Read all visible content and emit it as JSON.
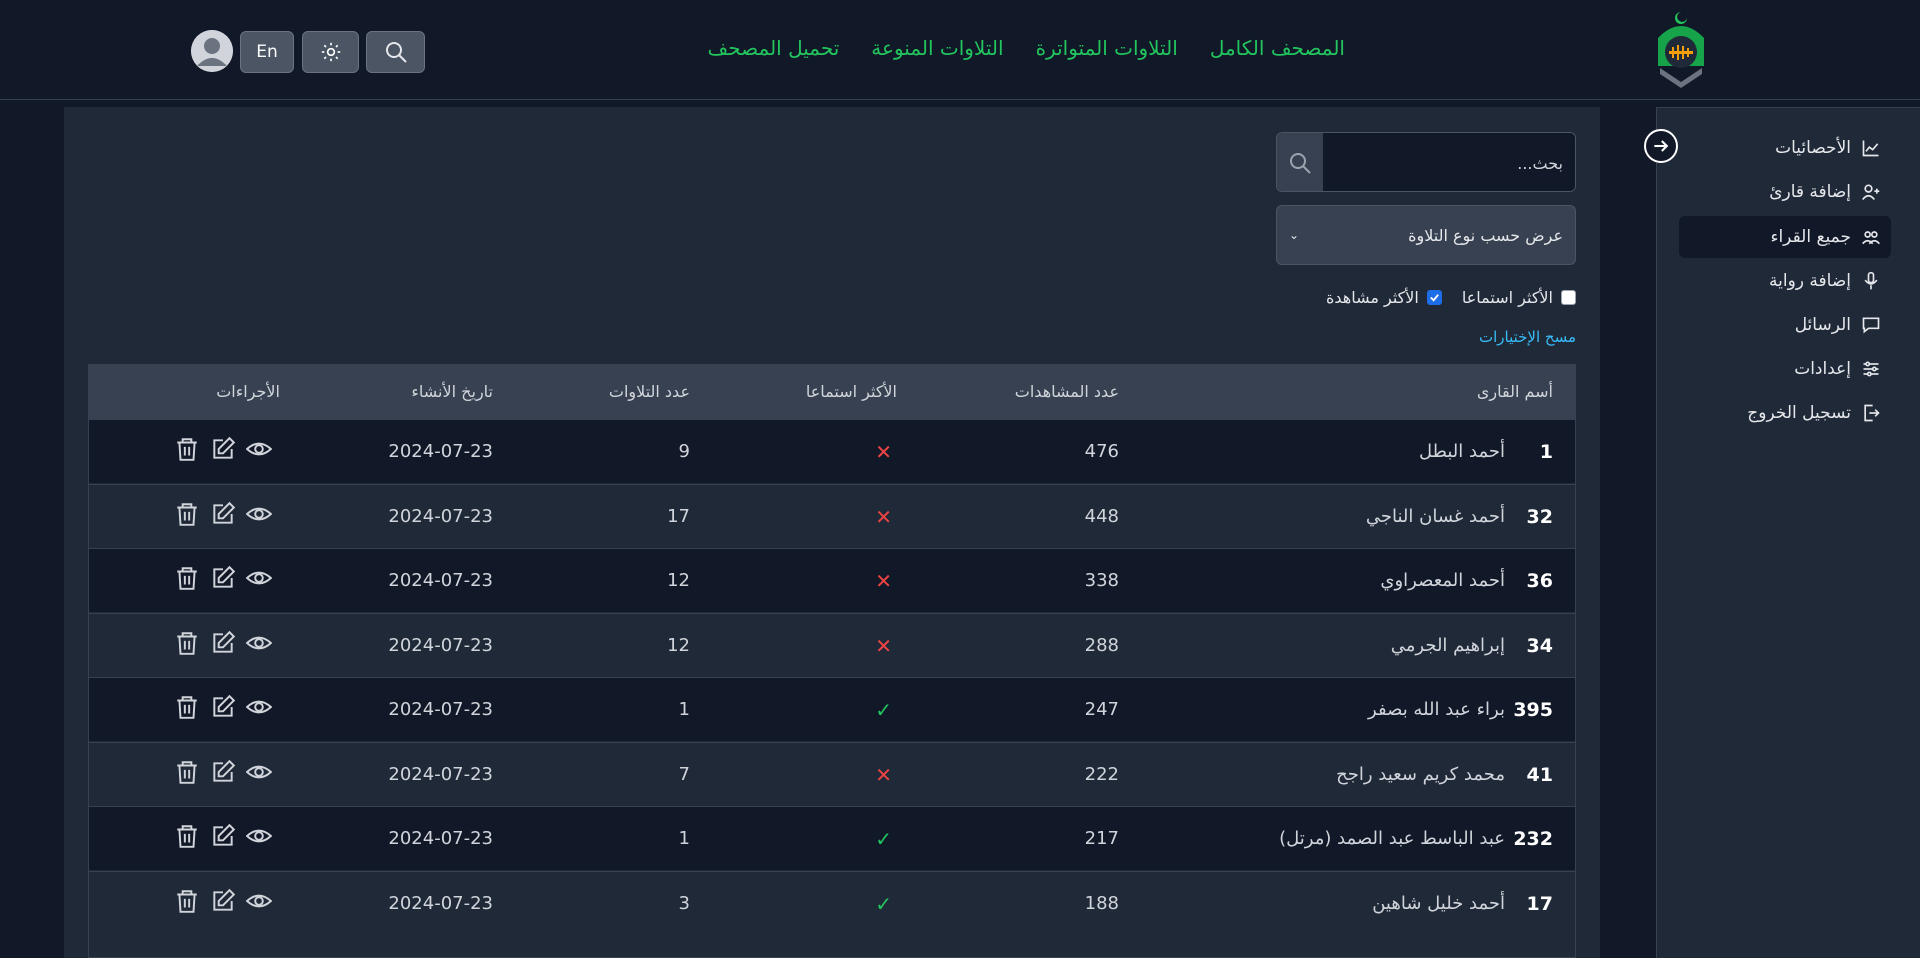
{
  "header": {
    "nav": [
      "المصحف الكامل",
      "التلاوات المتواترة",
      "التلاوات المنوعة",
      "تحميل المصحف"
    ],
    "lang_button": "En"
  },
  "sidebar": {
    "items": [
      {
        "label": "الأحصائيات",
        "icon": "chart-icon",
        "active": false
      },
      {
        "label": "إضافة قارئ",
        "icon": "user-plus-icon",
        "active": false
      },
      {
        "label": "جميع القراء",
        "icon": "users-icon",
        "active": true
      },
      {
        "label": "إضافة رواية",
        "icon": "microphone-icon",
        "active": false
      },
      {
        "label": "الرسائل",
        "icon": "chat-icon",
        "active": false
      },
      {
        "label": "إعدادات",
        "icon": "sliders-icon",
        "active": false
      },
      {
        "label": "تسجيل الخروج",
        "icon": "logout-icon",
        "active": false
      }
    ]
  },
  "filters": {
    "search_placeholder": "بحث...",
    "select_label": "عرض حسب نوع التلاوة",
    "check_most_listened": "الأكثر استماعا",
    "check_most_listened_checked": false,
    "check_most_viewed": "الأكثر مشاهدة",
    "check_most_viewed_checked": true,
    "clear_label": "مسح الإختيارات"
  },
  "table": {
    "headers": {
      "name": "أسم القارى",
      "views": "عدد المشاهدات",
      "most_listened": "الأكثر استماعا",
      "recitations": "عدد التلاوات",
      "created": "تاريخ الأنشاء",
      "actions": "الأجراءات"
    },
    "rows": [
      {
        "id": "1",
        "name": "أحمد البطل",
        "views": "476",
        "listened": "✕",
        "recitations": "9",
        "created": "2024-07-23"
      },
      {
        "id": "32",
        "name": "أحمد غسان الناجي",
        "views": "448",
        "listened": "✕",
        "recitations": "17",
        "created": "2024-07-23"
      },
      {
        "id": "36",
        "name": "أحمد المعصراوي",
        "views": "338",
        "listened": "✕",
        "recitations": "12",
        "created": "2024-07-23"
      },
      {
        "id": "34",
        "name": "إبراهيم الجرمي",
        "views": "288",
        "listened": "✕",
        "recitations": "12",
        "created": "2024-07-23"
      },
      {
        "id": "395",
        "name": "براء عبد الله بصفر",
        "views": "247",
        "listened": "✓",
        "recitations": "1",
        "created": "2024-07-23"
      },
      {
        "id": "41",
        "name": "محمد كريم سعيد راجح",
        "views": "222",
        "listened": "✕",
        "recitations": "7",
        "created": "2024-07-23"
      },
      {
        "id": "232",
        "name": "عبد الباسط عبد الصمد (مرتل)",
        "views": "217",
        "listened": "✓",
        "recitations": "1",
        "created": "2024-07-23"
      },
      {
        "id": "17",
        "name": "أحمد خليل شاهين",
        "views": "188",
        "listened": "✓",
        "recitations": "3",
        "created": "2024-07-23"
      }
    ]
  },
  "colors": {
    "accent_green": "#22c55e",
    "danger_red": "#ef4444",
    "link_blue": "#38bdf8",
    "panel": "#1f2937",
    "background": "#111827"
  }
}
